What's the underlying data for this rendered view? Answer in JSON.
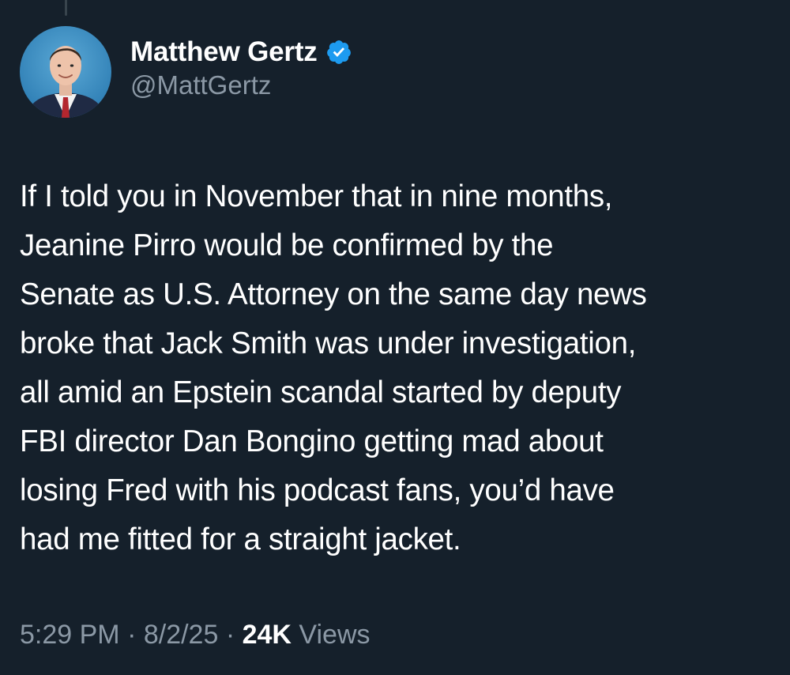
{
  "author": {
    "display_name": "Matthew Gertz",
    "handle": "@MattGertz",
    "verified": true,
    "verified_color": "#1d9bf0",
    "avatar_icon": "profile-photo"
  },
  "tweet": {
    "text_lines": [
      "If I told you in November that in nine months,",
      "Jeanine Pirro would be confirmed by the",
      "Senate as U.S. Attorney on the same day news",
      "broke that Jack Smith was under investigation,",
      "all amid an Epstein scandal started by deputy",
      "FBI director Dan Bongino getting mad about",
      "losing Fred with his podcast fans, you’d have",
      "had me fitted for a straight jacket."
    ]
  },
  "meta": {
    "time": "5:29 PM",
    "separator": " · ",
    "date": "8/2/25",
    "views_count": "24K",
    "views_label": " Views"
  },
  "colors": {
    "background": "#15202b",
    "primary_text": "#ffffff",
    "secondary_text": "#8b98a5"
  }
}
